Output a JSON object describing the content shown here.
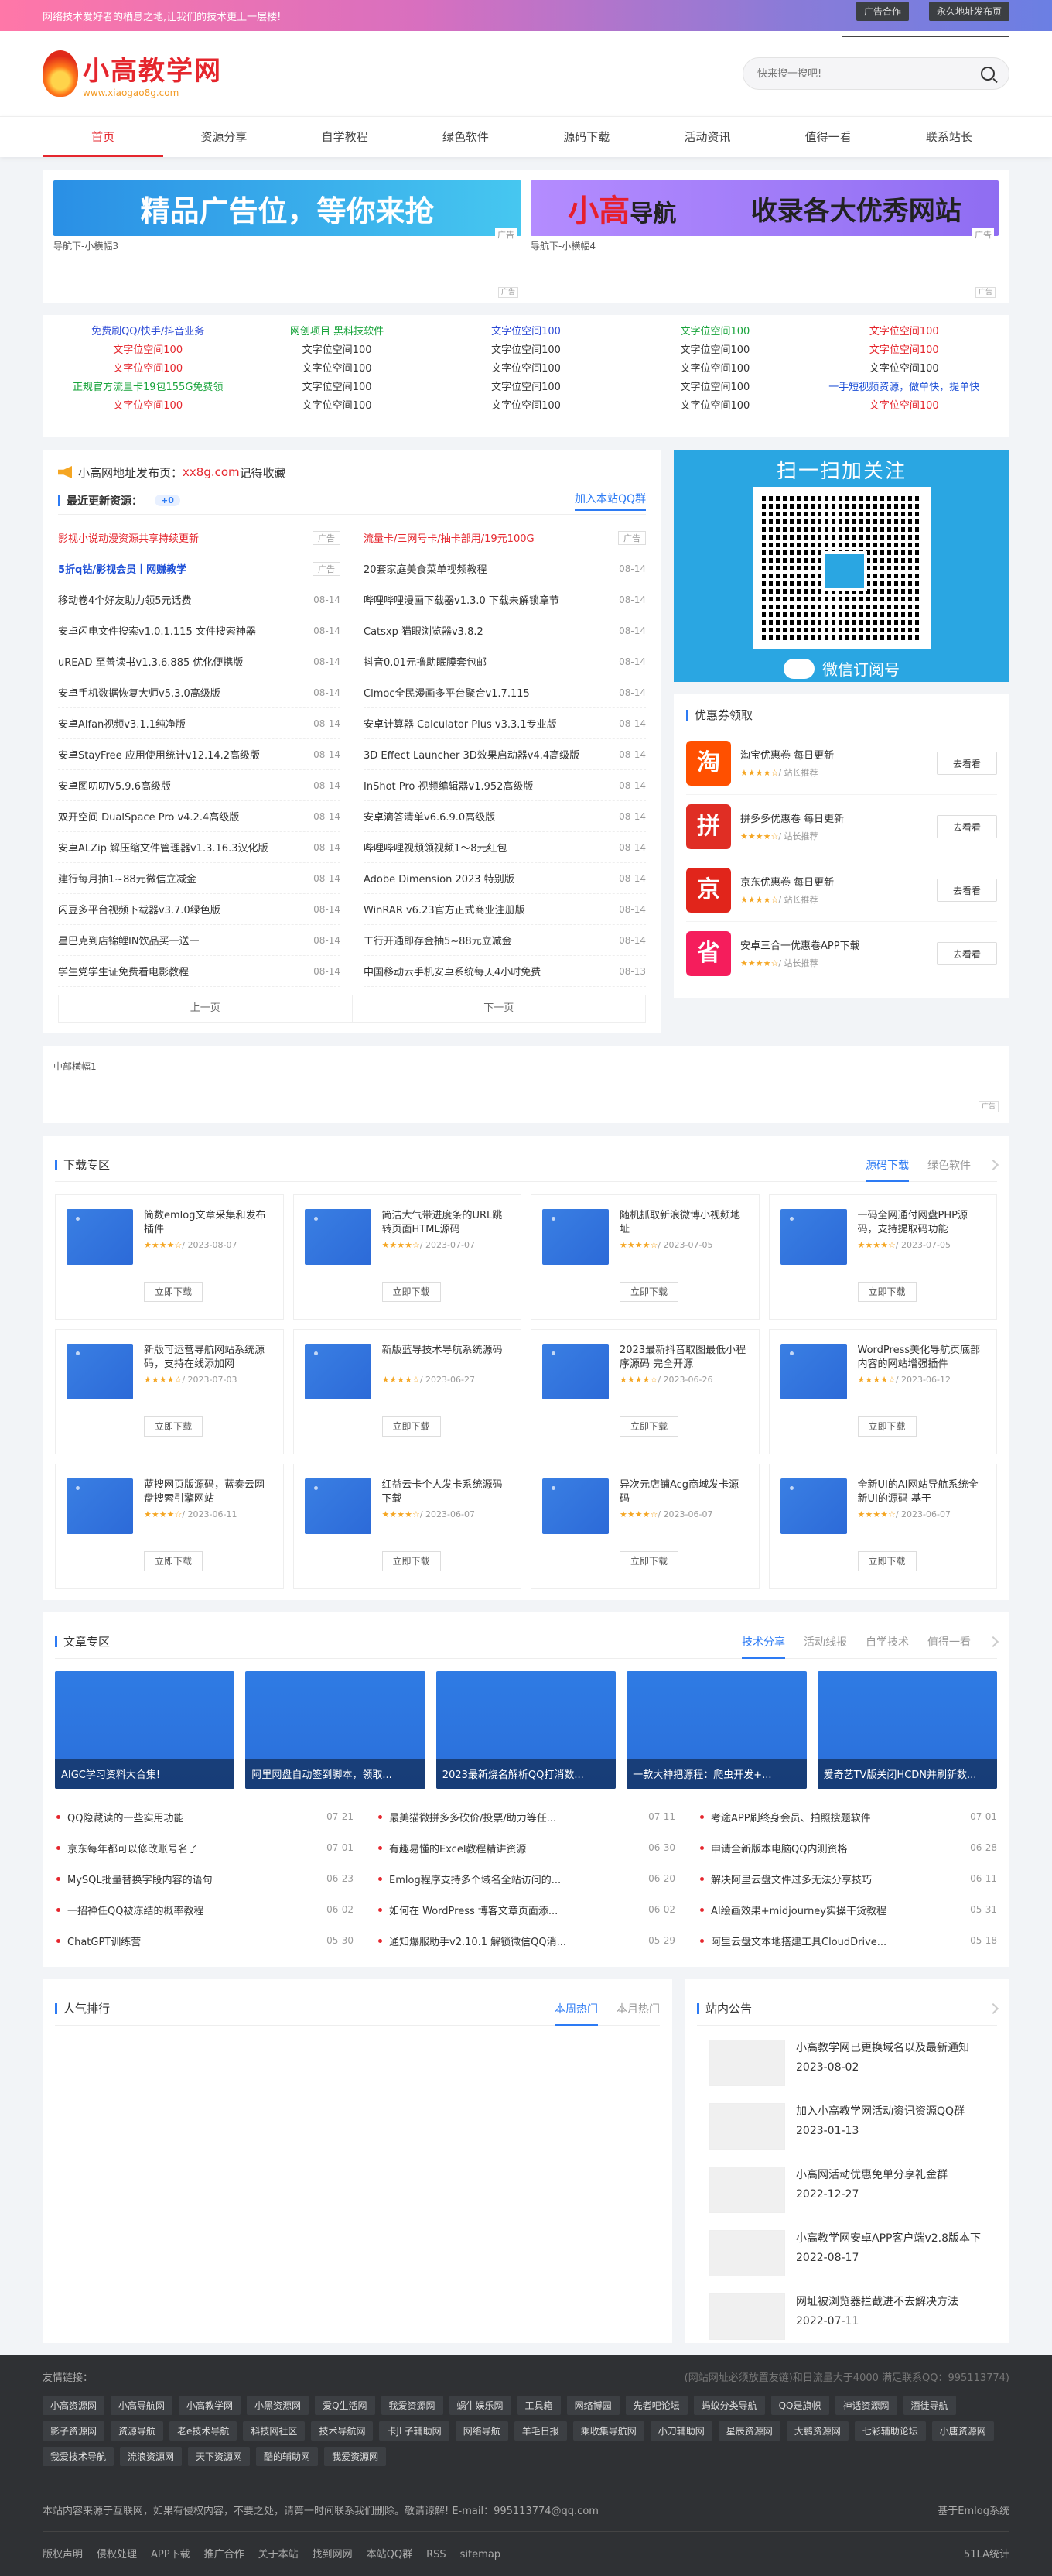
{
  "topbar": {
    "slogan": "网络技术爱好者的栖息之地,让我们的技术更上一层楼!",
    "links": [
      "广告合作",
      "永久地址发布页"
    ]
  },
  "logo": {
    "title": "小高教学网",
    "sub": "www.xiaogao8g.com"
  },
  "search": {
    "placeholder": "快来搜一搜吧!"
  },
  "nav": [
    "首页",
    "资源分享",
    "自学教程",
    "绿色软件",
    "源码下载",
    "活动资讯",
    "值得一看",
    "联系站长"
  ],
  "ads": {
    "banner1": "精品广告位，等你来抢",
    "banner2_logo1": "小",
    "banner2_logo2": "高",
    "banner2_logo3": "导航",
    "banner2_text": "收录各大优秀网站",
    "tag": "广告",
    "alt3": "导航下-小横幅3",
    "alt4": "导航下-小横幅4"
  },
  "textads": [
    [
      {
        "t": "免费刷QQ/快手/抖音业务",
        "c": "#2d4bd6"
      },
      {
        "t": "文字位空间100",
        "c": "#e5262d"
      },
      {
        "t": "文字位空间100",
        "c": "#e5262d"
      },
      {
        "t": "正规官方流量卡19包155G免费领",
        "c": "#17a33a"
      },
      {
        "t": "文字位空间100",
        "c": "#e5262d"
      }
    ],
    [
      {
        "t": "网创项目 黑科技软件",
        "c": "#17a33a"
      },
      {
        "t": "文字位空间100",
        "c": "#333"
      },
      {
        "t": "文字位空间100",
        "c": "#333"
      },
      {
        "t": "文字位空间100",
        "c": "#333"
      },
      {
        "t": "文字位空间100",
        "c": "#333"
      }
    ],
    [
      {
        "t": "文字位空间100",
        "c": "#2d4bd6"
      },
      {
        "t": "文字位空间100",
        "c": "#333"
      },
      {
        "t": "文字位空间100",
        "c": "#333"
      },
      {
        "t": "文字位空间100",
        "c": "#333"
      },
      {
        "t": "文字位空间100",
        "c": "#333"
      }
    ],
    [
      {
        "t": "文字位空间100",
        "c": "#17a33a"
      },
      {
        "t": "文字位空间100",
        "c": "#333"
      },
      {
        "t": "文字位空间100",
        "c": "#333"
      },
      {
        "t": "文字位空间100",
        "c": "#333"
      },
      {
        "t": "文字位空间100",
        "c": "#333"
      }
    ],
    [
      {
        "t": "文字位空间100",
        "c": "#e5262d"
      },
      {
        "t": "文字位空间100",
        "c": "#e5262d"
      },
      {
        "t": "文字位空间100",
        "c": "#333"
      },
      {
        "t": "一手短视频资源，做单快，提单快",
        "c": "#1d4fd6"
      },
      {
        "t": "文字位空间100",
        "c": "#e5262d"
      }
    ]
  ],
  "notice": {
    "prefix": "小高网地址发布页：",
    "url": "xx8g.com",
    "suffix": "记得收藏"
  },
  "updates": {
    "title": "最近更新资源：",
    "count": "+0",
    "qq": "加入本站QQ群",
    "prev": "上一页",
    "next": "下一页",
    "left": [
      {
        "t": "影视小说动漫资源共享持续更新",
        "d": "广告",
        "k": "hot"
      },
      {
        "t": "5折q钻/影视会员丨网赚教学",
        "d": "广告",
        "k": "blue"
      },
      {
        "t": "移动卷4个好友助力领5元话费",
        "d": "08-14",
        "k": ""
      },
      {
        "t": "安卓闪电文件搜索v1.0.1.115 文件搜索神器",
        "d": "08-14",
        "k": ""
      },
      {
        "t": "uREAD 至善读书v1.3.6.885 优化便携版",
        "d": "08-14",
        "k": ""
      },
      {
        "t": "安卓手机数据恢复大师v5.3.0高级版",
        "d": "08-14",
        "k": ""
      },
      {
        "t": "安卓Alfan视频v3.1.1纯净版",
        "d": "08-14",
        "k": ""
      },
      {
        "t": "安卓StayFree 应用使用统计v12.14.2高级版",
        "d": "08-14",
        "k": ""
      },
      {
        "t": "安卓图叨叨V5.9.6高级版",
        "d": "08-14",
        "k": ""
      },
      {
        "t": "双开空间 DualSpace Pro v4.2.4高级版",
        "d": "08-14",
        "k": ""
      },
      {
        "t": "安卓ALZip 解压缩文件管理器v1.3.16.3汉化版",
        "d": "08-14",
        "k": ""
      },
      {
        "t": "建行每月抽1~88元微信立减金",
        "d": "08-14",
        "k": ""
      },
      {
        "t": "闪豆多平台视频下载器v3.7.0绿色版",
        "d": "08-14",
        "k": ""
      },
      {
        "t": "星巴克到店锦鲤IN饮品买一送一",
        "d": "08-14",
        "k": ""
      },
      {
        "t": "学生党学生证免费看电影教程",
        "d": "08-14",
        "k": ""
      }
    ],
    "right": [
      {
        "t": "流量卡/三网号卡/抽卡部用/19元100G",
        "d": "广告",
        "k": "hot"
      },
      {
        "t": "20套家庭美食菜单视频教程",
        "d": "08-14",
        "k": ""
      },
      {
        "t": "哔哩哔哩漫画下载器v1.3.0 下载未解锁章节",
        "d": "08-14",
        "k": ""
      },
      {
        "t": "Catsxp 猫眼浏览器v3.8.2",
        "d": "08-14",
        "k": ""
      },
      {
        "t": "抖音0.01元撸助眠膜套包邮",
        "d": "08-14",
        "k": ""
      },
      {
        "t": "Clmoc全民漫画多平台聚合v1.7.115",
        "d": "08-14",
        "k": ""
      },
      {
        "t": "安卓计算器 Calculator Plus v3.3.1专业版",
        "d": "08-14",
        "k": ""
      },
      {
        "t": "3D Effect Launcher 3D效果启动器v4.4高级版",
        "d": "08-14",
        "k": ""
      },
      {
        "t": "InShot Pro 视频编辑器v1.952高级版",
        "d": "08-14",
        "k": ""
      },
      {
        "t": "安卓滴答清单v6.6.9.0高级版",
        "d": "08-14",
        "k": ""
      },
      {
        "t": "哔哩哔哩视频领视频1～8元红包",
        "d": "08-14",
        "k": ""
      },
      {
        "t": "Adobe Dimension 2023 特别版",
        "d": "08-14",
        "k": ""
      },
      {
        "t": "WinRAR v6.23官方正式商业注册版",
        "d": "08-14",
        "k": ""
      },
      {
        "t": "工行开通即存金抽5~88元立减金",
        "d": "08-14",
        "k": ""
      },
      {
        "t": "中国移动云手机安卓系统每天4小时免费",
        "d": "08-13",
        "k": ""
      }
    ]
  },
  "qr": {
    "title": "扫一扫加关注",
    "foot": "微信订阅号"
  },
  "coupons": {
    "title": "优惠券领取",
    "items": [
      {
        "icon": "淘",
        "color": "#ff5000",
        "name": "淘宝优惠卷 每日更新",
        "go": "去看看"
      },
      {
        "icon": "拼",
        "color": "#e02e24",
        "name": "拼多多优惠卷 每日更新",
        "go": "去看看"
      },
      {
        "icon": "京",
        "color": "#e1251b",
        "name": "京东优惠卷 每日更新",
        "go": "去看看"
      },
      {
        "icon": "省",
        "color": "#f51d5c",
        "name": "安卓三合一优惠卷APP下载",
        "go": "去看看"
      }
    ],
    "meta": "★★★★☆",
    "sub": "/ 站长推荐"
  },
  "midad": {
    "alt": "中部横幅1",
    "tag": "广告"
  },
  "download": {
    "title": "下载专区",
    "tabs": [
      "源码下载",
      "绿色软件"
    ],
    "btn": "立即下载",
    "stars": "★★★★☆",
    "items": [
      {
        "n": "简数emlog文章采集和发布插件",
        "d": "/ 2023-08-07"
      },
      {
        "n": "简洁大气带进度条的URL跳转页面HTML源码",
        "d": "/ 2023-07-07"
      },
      {
        "n": "随机抓取新浪微博小视频地址",
        "d": "/ 2023-07-05"
      },
      {
        "n": "一码全网通付网盘PHP源码，支持提取码功能",
        "d": "/ 2023-07-05"
      },
      {
        "n": "新版可运营导航网站系统源码，支持在线添加网",
        "d": "/ 2023-07-03"
      },
      {
        "n": "新版蓝导技术导航系统源码",
        "d": "/ 2023-06-27"
      },
      {
        "n": "2023最新抖音取图最低小程序源码 完全开源",
        "d": "/ 2023-06-26"
      },
      {
        "n": "WordPress美化导航页底部内容的网站增强插件",
        "d": "/ 2023-06-12"
      },
      {
        "n": "蓝搜网页版源码，蓝奏云网盘搜索引擎网站",
        "d": "/ 2023-06-11"
      },
      {
        "n": "红益云卡个人发卡系统源码下载",
        "d": "/ 2023-06-07"
      },
      {
        "n": "异次元店铺Acg商城发卡源码",
        "d": "/ 2023-06-07"
      },
      {
        "n": "全新UI的AI网站导航系统全新UI的源码 基于",
        "d": "/ 2023-06-07"
      }
    ]
  },
  "articles": {
    "title": "文章专区",
    "tabs": [
      "技术分享",
      "活动线报",
      "自学技术",
      "值得一看"
    ],
    "cards": [
      "AIGC学习资料大合集!",
      "阿里网盘自动签到脚本，领取...",
      "2023最新烧名解析QQ打消数...",
      "一款大神把源程：爬虫开发+...",
      "爱奇艺TV版关闭HCDN并刷新数..."
    ],
    "list": [
      {
        "t": "QQ隐藏读的一些实用功能",
        "d": "07-21"
      },
      {
        "t": "最美猫微拼多多砍价/投票/助力等任...",
        "d": "07-11"
      },
      {
        "t": "考途APP刷终身会员、拍照搜题软件",
        "d": "07-01"
      },
      {
        "t": "京东每年都可以修改账号名了",
        "d": "07-01"
      },
      {
        "t": "有趣易懂的Excel教程精讲资源",
        "d": "06-30"
      },
      {
        "t": "申请全新版本电脑QQ内测资格",
        "d": "06-28"
      },
      {
        "t": "MySQL批量替换字段内容的语句",
        "d": "06-23"
      },
      {
        "t": "Emlog程序支持多个域名全站访问的...",
        "d": "06-20"
      },
      {
        "t": "解决阿里云盘文件过多无法分享技巧",
        "d": "06-11"
      },
      {
        "t": "一招禅任QQ被冻结的概率教程",
        "d": "06-02"
      },
      {
        "t": "如何在 WordPress 博客文章页面添...",
        "d": "06-02"
      },
      {
        "t": "AI绘画效果+midjourney实操干货教程",
        "d": "05-31"
      },
      {
        "t": "ChatGPT训练营",
        "d": "05-30"
      },
      {
        "t": "通知爆服助手v2.10.1 解锁微信QQ消...",
        "d": "05-29"
      },
      {
        "t": "阿里云盘文本地搭建工具CloudDrive...",
        "d": "05-18"
      }
    ]
  },
  "rank": {
    "title": "人气排行",
    "tabs": [
      "本周热门",
      "本月热门"
    ]
  },
  "site_notice": {
    "title": "站内公告",
    "items": [
      {
        "n": "小高教学网已更换域名以及最新通知",
        "d": "2023-08-02"
      },
      {
        "n": "加入小高教学网活动资讯资源QQ群",
        "d": "2023-01-13"
      },
      {
        "n": "小高网活动优惠免单分享礼金群",
        "d": "2022-12-27"
      },
      {
        "n": "小高教学网安卓APP客户端v2.8版本下",
        "d": "2022-08-17"
      },
      {
        "n": "网址被浏览器拦截进不去解决方法",
        "d": "2022-07-11"
      }
    ]
  },
  "footer": {
    "friends": "友情链接：",
    "right_note": "(网站网址必须放置友链)和日流量大于4000 满足联系QQ：995113774)",
    "links": [
      "小高资源网",
      "小高导航网",
      "小高教学网",
      "小黑资源网",
      "爱Q生活网",
      "我爱资源网",
      "蜗牛娱乐网",
      "工具箱",
      "网络博园",
      "先者吧论坛",
      "蚂蚁分类导航",
      "QQ是旗帜",
      "神话资源网",
      "酒徒导航",
      "影子资源网",
      "资源导航",
      "老e技术导航",
      "科技网社区",
      "技术导航网",
      "卡JL子辅助网",
      "网络导航",
      "羊毛日报",
      "乘收集导航网",
      "小刀辅助网",
      "星辰资源网",
      "大鹏资源网",
      "七彩辅助论坛",
      "小唐资源网",
      "我爱技术导航",
      "流浪资源网",
      "天下资源网",
      "酷的辅助网",
      "我爱资源网"
    ],
    "disclaimer": "本站内容来源于互联网，如果有侵权内容，不要之处，请第一时间联系我们删除。敬请谅解! E-mail：995113774@qq.com",
    "based": "基于Emlog系统",
    "menu": [
      "版权声明",
      "侵权处理",
      "APP下载",
      "推广合作",
      "关于本站",
      "找到网网",
      "本站QQ群",
      "RSS",
      "sitemap"
    ],
    "stat": "51LA统计"
  }
}
